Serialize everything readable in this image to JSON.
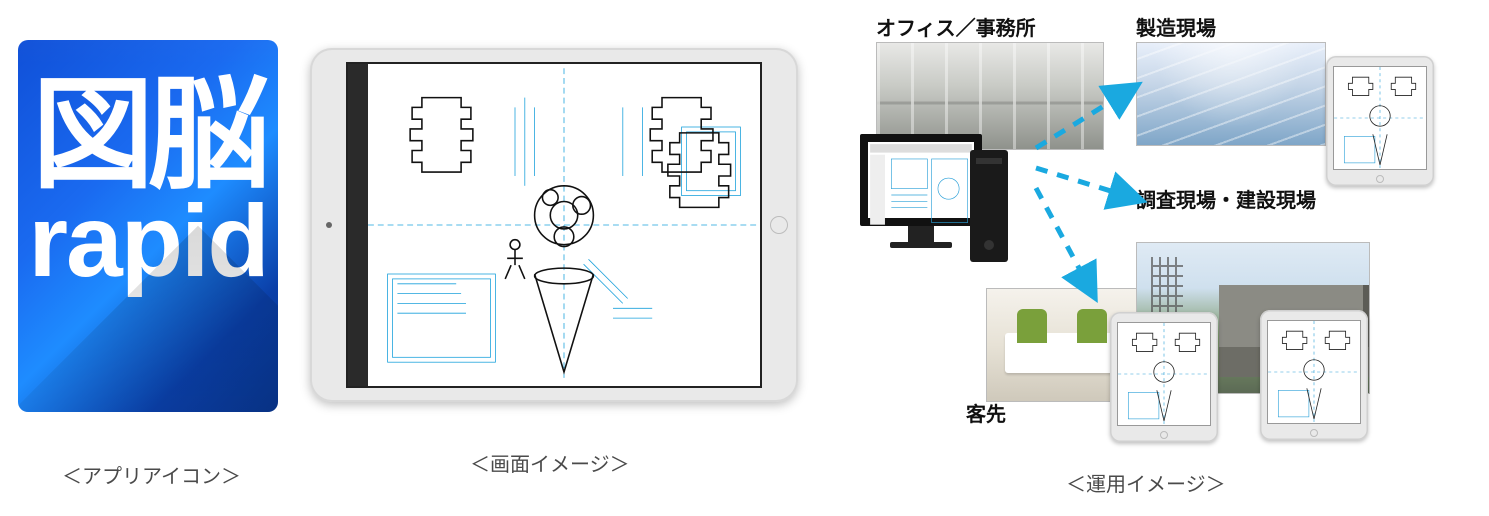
{
  "app_icon": {
    "jp_text": "図脳",
    "en_text": "rapid"
  },
  "captions": {
    "icon_caption": "＜アプリアイコン＞",
    "screen_caption": "＜画面イメージ＞",
    "ops_caption": "＜運用イメージ＞"
  },
  "ops": {
    "office_label": "オフィス／事務所",
    "factory_label": "製造現場",
    "construction_label": "調査現場・建設現場",
    "client_label": "客先"
  }
}
